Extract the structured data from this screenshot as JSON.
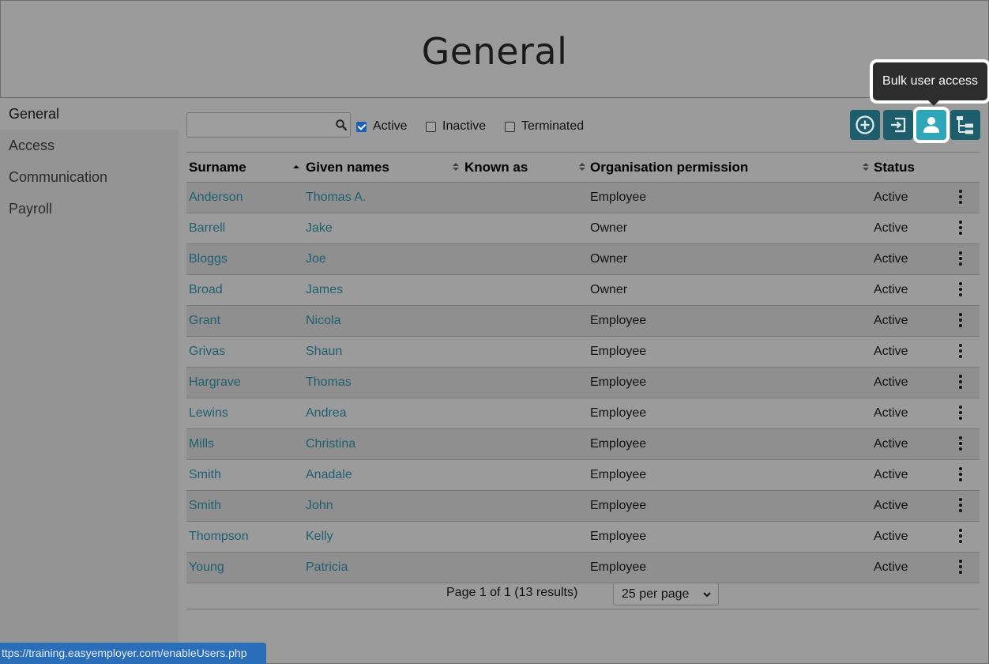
{
  "page": {
    "title": "General"
  },
  "sidebar": {
    "items": [
      {
        "label": "General"
      },
      {
        "label": "Access"
      },
      {
        "label": "Communication"
      },
      {
        "label": "Payroll"
      }
    ]
  },
  "search": {
    "value": "",
    "placeholder": ""
  },
  "filters": [
    {
      "label": "Active",
      "checked": true
    },
    {
      "label": "Inactive",
      "checked": false
    },
    {
      "label": "Terminated",
      "checked": false
    }
  ],
  "toolbar": {
    "tooltip": "Bulk user access",
    "buttons": [
      {
        "icon": "add-circle-icon"
      },
      {
        "icon": "sign-in-icon"
      },
      {
        "icon": "person-icon"
      },
      {
        "icon": "hierarchy-icon"
      }
    ]
  },
  "table": {
    "columns": [
      "Surname",
      "Given names",
      "Known as",
      "Organisation permission",
      "Status"
    ],
    "rows": [
      {
        "surname": "Anderson",
        "given": "Thomas A.",
        "known": "",
        "permission": "Employee",
        "status": "Active"
      },
      {
        "surname": "Barrell",
        "given": "Jake",
        "known": "",
        "permission": "Owner",
        "status": "Active"
      },
      {
        "surname": "Bloggs",
        "given": "Joe",
        "known": "",
        "permission": "Owner",
        "status": "Active"
      },
      {
        "surname": "Broad",
        "given": "James",
        "known": "",
        "permission": "Owner",
        "status": "Active"
      },
      {
        "surname": "Grant",
        "given": "Nicola",
        "known": "",
        "permission": "Employee",
        "status": "Active"
      },
      {
        "surname": "Grivas",
        "given": "Shaun",
        "known": "",
        "permission": "Employee",
        "status": "Active"
      },
      {
        "surname": "Hargrave",
        "given": "Thomas",
        "known": "",
        "permission": "Employee",
        "status": "Active"
      },
      {
        "surname": "Lewins",
        "given": "Andrea",
        "known": "",
        "permission": "Employee",
        "status": "Active"
      },
      {
        "surname": "Mills",
        "given": "Christina",
        "known": "",
        "permission": "Employee",
        "status": "Active"
      },
      {
        "surname": "Smith",
        "given": "Anadale",
        "known": "",
        "permission": "Employee",
        "status": "Active"
      },
      {
        "surname": "Smith",
        "given": "John",
        "known": "",
        "permission": "Employee",
        "status": "Active"
      },
      {
        "surname": "Thompson",
        "given": "Kelly",
        "known": "",
        "permission": "Employee",
        "status": "Active"
      },
      {
        "surname": "Young",
        "given": "Patricia",
        "known": "",
        "permission": "Employee",
        "status": "Active"
      }
    ]
  },
  "pagination": {
    "text": "Page 1 of 1 (13 results)",
    "per_page": "25 per page"
  },
  "statusbar": {
    "url": "ttps://training.easyemployer.com/enableUsers.php"
  },
  "colors": {
    "accent": "#1e5e6c",
    "accent_active": "#2da6b8",
    "link": "#1f5f72"
  }
}
